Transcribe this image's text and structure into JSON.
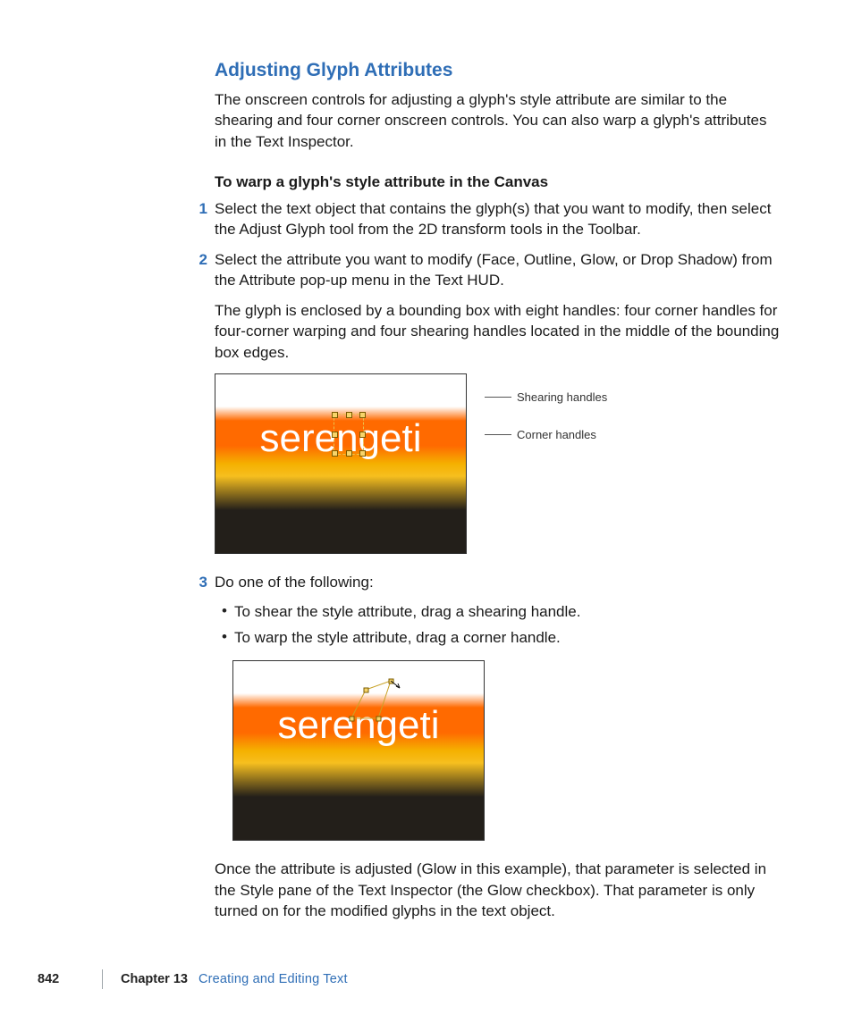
{
  "heading": "Adjusting Glyph Attributes",
  "intro": "The onscreen controls for adjusting a glyph's style attribute are similar to the shearing and four corner onscreen controls. You can also warp a glyph's attributes in the Text Inspector.",
  "task_heading": "To warp a glyph's style attribute in the Canvas",
  "steps": {
    "one_num": "1",
    "one": "Select the text object that contains the glyph(s) that you want to modify, then select the Adjust Glyph tool from the 2D transform tools in the Toolbar.",
    "two_num": "2",
    "two": "Select the attribute you want to modify (Face, Outline, Glow, or Drop Shadow) from the Attribute pop-up menu in the Text HUD.",
    "two_follow": "The glyph is enclosed by a bounding box with eight handles: four corner handles for four-corner warping and four shearing handles located in the middle of the bounding box edges.",
    "three_num": "3",
    "three": "Do one of the following:",
    "bullet_a": "To shear the style attribute, drag a shearing handle.",
    "bullet_b": "To warp the style attribute, drag a corner handle.",
    "outro": "Once the attribute is adjusted (Glow in this example), that parameter is selected in the Style pane of the Text Inspector (the Glow checkbox). That parameter is only turned on for the modified glyphs in the text object."
  },
  "figure": {
    "word": "serengeti",
    "label_shearing": "Shearing handles",
    "label_corner": "Corner handles"
  },
  "footer": {
    "page": "842",
    "chapter": "Chapter 13",
    "title": "Creating and Editing Text"
  }
}
